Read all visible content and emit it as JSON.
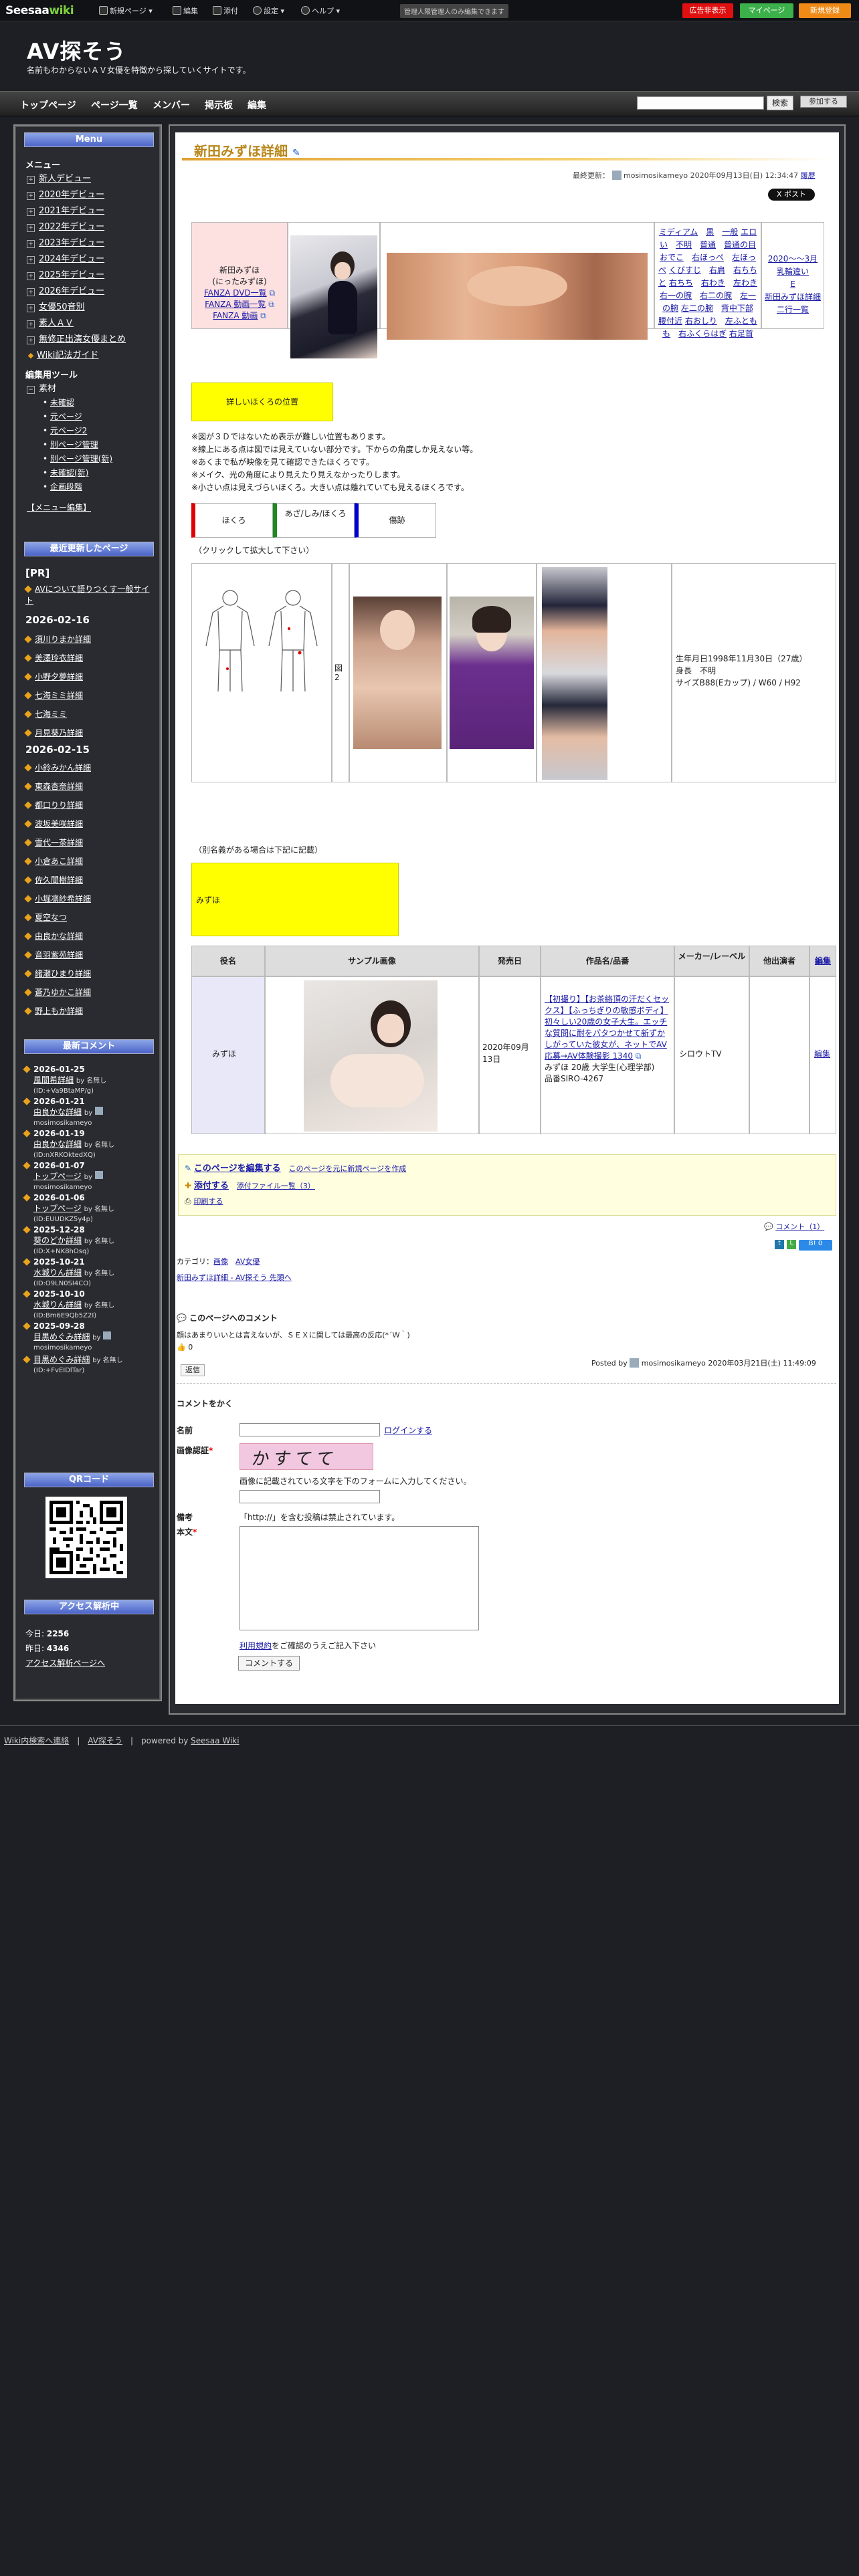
{
  "topbar": {
    "logo_a": "Seesaa",
    "logo_b": "wiki",
    "items": [
      "新規ページ ▾",
      "編集",
      "添付",
      "設定 ▾",
      "ヘルプ ▾"
    ],
    "notice": "管理人限管理人のみ編集できます",
    "btn_ad": "広告非表示",
    "btn_mypage": "マイページ",
    "btn_register": "新規登録"
  },
  "header": {
    "title": "AV探そう",
    "subtitle": "名前もわからないＡＶ女優を特徴から探していくサイトです。"
  },
  "nav": {
    "items": [
      "トップページ",
      "ページ一覧",
      "メンバー",
      "掲示板",
      "編集"
    ],
    "search_btn": "検索",
    "join": "参加する"
  },
  "sidebar": {
    "menu_title": "Menu",
    "menu_heading": "メニュー",
    "menu_items": [
      "新人デビュー",
      "2020年デビュー",
      "2021年デビュー",
      "2022年デビュー",
      "2023年デビュー",
      "2024年デビュー",
      "2025年デビュー",
      "2026年デビュー",
      "女優50音別",
      "素人ＡＶ",
      "無修正出演女優まとめ",
      "Wiki記法ガイド"
    ],
    "edit_heading": "編集用ツール",
    "edit_root": "素材",
    "edit_items": [
      "未確認",
      "元ページ",
      "元ページ2",
      "別ページ管理",
      "別ページ管理(新)",
      "未確認(新)",
      "企画段階"
    ],
    "menu_edit": "【メニュー編集】",
    "recent_title": "最近更新したページ",
    "recent_pr": "[PR]",
    "recent_pr_link": "AVについて語りつくす一般サイト",
    "date1": "2026-02-16",
    "recent1": [
      "須川りまか詳細",
      "美澤玲衣詳細",
      "小野夕夢詳細",
      "七海ミミ詳細",
      "七海ミミ",
      "月見葵乃詳細"
    ],
    "date2": "2026-02-15",
    "recent2": [
      "小鈴みかん詳細",
      "東森杏奈詳細",
      "都口りり詳細",
      "波坂美咲詳細",
      "雪代一茶詳細",
      "小倉あこ詳細",
      "佐久間樹詳細",
      "小堀凛紗希詳細",
      "夏空なつ",
      "由良かな詳細",
      "音羽紫苑詳細",
      "緒瀬ひまり詳細",
      "蒼乃ゆかこ詳細",
      "野上もか詳細"
    ],
    "comments_title": "最新コメント",
    "comments": [
      {
        "date": "2026-01-25",
        "link": "風間希詳細",
        "by": "by 名無し",
        "id": "(ID:+Va9BtaMP/g)"
      },
      {
        "date": "2026-01-21",
        "link": "由良かな詳細",
        "by": "by",
        "id": "mosimosikameyo"
      },
      {
        "date": "2026-01-19",
        "link": "由良かな詳細",
        "by": "by 名無し",
        "id": "(ID:nXRKOktedXQ)"
      },
      {
        "date": "2026-01-07",
        "link": "トップページ",
        "by": "by",
        "id": "mosimosikameyo"
      },
      {
        "date": "2026-01-06",
        "link": "トップページ",
        "by": "by 名無し",
        "id": "(ID:EUUDKZ5y4p)"
      },
      {
        "date": "2025-12-28",
        "link": "葵のどか詳細",
        "by": "by 名無し",
        "id": "(ID:X+NK8hOsq)"
      },
      {
        "date": "2025-10-21",
        "link": "水城りん詳細",
        "by": "by 名無し",
        "id": "(ID:O9LN0SI4CO)"
      },
      {
        "date": "2025-10-10",
        "link": "水城りん詳細",
        "by": "by 名無し",
        "id": "(ID:Bm6E9Qb5Z2I)"
      },
      {
        "date": "2025-09-28",
        "link": "目黒めぐみ詳細",
        "by": "by",
        "id": "mosimosikameyo"
      },
      {
        "date": "",
        "link": "目黒めぐみ詳細",
        "by": "by 名無し",
        "id": "(ID:+FvEIDlTar)"
      }
    ],
    "qr_title": "QRコード",
    "access_title": "アクセス解析中",
    "access_today_label": "今日: ",
    "access_today": "2256",
    "access_yesterday_label": "昨日: ",
    "access_yesterday": "4346",
    "access_link": "アクセス解析ページへ"
  },
  "main": {
    "title": "新田みずほ詳細",
    "updated": "最終更新：",
    "updated_user": "mosimosikameyo",
    "updated_date": "2020年09月13日(日) 12:34:47",
    "updated_history": "履歴",
    "post_btn": "X ポスト",
    "profile_name": "新田みずほ",
    "profile_kana": "(にったみずほ)",
    "links": [
      "FANZA DVD一覧",
      "FANZA 動画一覧",
      "FANZA 動画"
    ],
    "tags": [
      "ミディアム",
      "黒",
      "一般",
      "エロい",
      "不明",
      "普通",
      "普通の目",
      "おでこ",
      "右ほっぺ",
      "左ほっぺ",
      "くびすじ",
      "右肩",
      "右ちちと",
      "右ちち",
      "右わき",
      "左わき",
      "右一の腕",
      "右二の腕",
      "左一の腕",
      "左二の腕",
      "背中下部",
      "腰付近",
      "右おしり",
      "左ふともも",
      "右ふくらはぎ",
      "右足首"
    ],
    "year_col": [
      "2020～～3月",
      "乳輪違い",
      "E",
      "新田みずほ詳細",
      "二行一覧"
    ],
    "mole_btn": "詳しいほくろの位置",
    "notes": [
      "※図が３Ｄではないため表示が難しい位置もあります。",
      "※線上にある点は図では見えていない部分です。下からの角度しか見えない等。",
      "※あくまで私が映像を見て確認できたほくろです。",
      "※メイク、光の角度により見えたり見えなかったりします。",
      "※小さい点は見えづらいほくろ。大きい点は離れていても見えるほくろです。"
    ],
    "legend": [
      "ほくろ",
      "あざ/しみ/ほくろ",
      "傷跡"
    ],
    "enlarge_note": "（クリックして拡大して下さい）",
    "fig_label": "図2",
    "birth": "生年月日1998年11月30日（27歳）",
    "height": "身長　不明",
    "size": "サイズB88(Eカップ) / W60 / H92",
    "alias_note": "（別名義がある場合は下記に記載）",
    "alias": "みずほ",
    "table_headers": [
      "役名",
      "サンプル画像",
      "発売日",
      "作品名/品番",
      "メーカー/レーベル",
      "他出演者",
      "編集"
    ],
    "row": {
      "role": "みずほ",
      "date": "2020年09月13日",
      "work_link": "【初撮り】【お茶絡頂の汗だくセックス】【ふっちぎりの敏感ボディ】初々しい20歳の女子大生。エッチな質問に耐をパタつかせて新ずかしがっていた彼女が、ネットでAV応募→AV体験撮影 1340",
      "work_desc": "みずほ 20歳 大学生(心理学部)",
      "work_code": "品番SIRO-4267",
      "maker": "シロウトTV",
      "edit": "編集"
    },
    "edit_box": {
      "edit_page": "このページを編集する",
      "new_page": "このページを元に新規ページを作成",
      "attach": "添付する",
      "attach_list": "添付ファイル一覧（3）",
      "print": "印刷する"
    },
    "comment_count": "コメント（1）",
    "category_label": "カテゴリ：",
    "categories": [
      "画像",
      "AV女優"
    ],
    "breadcrumb": "新田みずほ詳細 - AV探そう 先頭へ",
    "comment_section_title": "このページへのコメント",
    "comment_text": "顔はあまりいいとは言えないが、ＳＥＸに関しては最高の反応(*´Ｗ｀)",
    "comment_like": "0",
    "comment_posted": "Posted by",
    "comment_user": "mosimosikameyo",
    "comment_date": "2020年03月21日(土) 11:49:09",
    "reply_btn": "返信",
    "form_title": "コメントをかく",
    "form_name": "名前",
    "form_login": "ログインする",
    "form_captcha": "画像認証",
    "form_captcha_text": "かすてて",
    "form_captcha_note": "画像に記載されている文字を下のフォームに入力してください。",
    "form_memo": "備考",
    "form_http_note": "「http://」を含む投稿は禁止されています。",
    "form_body": "本文",
    "form_terms_a": "利用規約",
    "form_terms_b": "をご確認のうえご記入下さい",
    "form_submit": "コメントする"
  },
  "footer": {
    "admin": "Wiki内検索へ連絡",
    "site": "AV探そう",
    "powered": "powered by",
    "powered_link": "Seesaa Wiki"
  },
  "colors": {
    "accent": "#b8871b",
    "yellow": "#ffff00",
    "nav_blue": "#4a63c9"
  }
}
